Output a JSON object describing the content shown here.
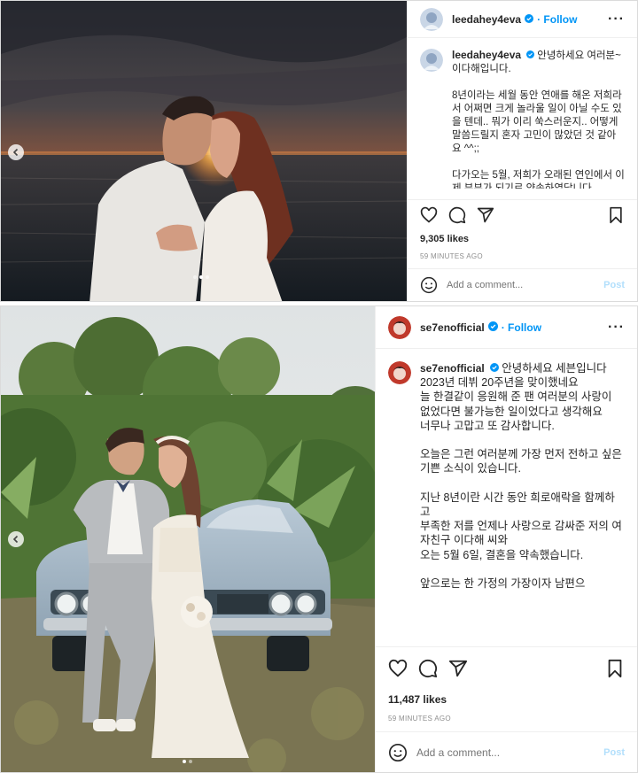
{
  "posts": [
    {
      "username": "leedahey4eva",
      "follow_label": "Follow",
      "more_label": "···",
      "caption": "안녕하세요 여러분~\n이다해입니다.\n\n8년이라는 세월 동안 연애를 해온 저희라서 어쩌면 크게 놀라울 일이 아닐 수도 있을 텐데.. 뭐가 이리 쑥스러운지.. 어떻게 말씀드릴지 혼자 고민이 많았던 것 같아요 ^^;;\n\n다가오는 5월, 저희가 오래된 연인에서 이제 부부가 되기로 약속하였답니다",
      "likes": "9,305 likes",
      "time": "59 MINUTES AGO",
      "comment_placeholder": "Add a comment...",
      "post_label": "Post"
    },
    {
      "username": "se7enofficial",
      "follow_label": "Follow",
      "more_label": "···",
      "caption": "안녕하세요 세븐입니다\n2023년 데뷔 20주년을 맞이했네요\n늘 한결같이 응원해 준 팬 여러분의 사랑이\n없었다면 불가능한 일이었다고 생각해요\n너무나 고맙고 또 감사합니다.\n\n오늘은 그런 여러분께 가장 먼저 전하고 싶은\n기쁜 소식이 있습니다.\n\n지난 8년이란 시간 동안 희로애락을 함께하고\n부족한 저를 언제나 사랑으로 감싸준 저의 여자친구 이다해 씨와\n오는 5월 6일, 결혼을 약속했습니다.\n\n앞으로는 한 가정의 가장이자 남편으",
      "likes": "11,487 likes",
      "time": "59 MINUTES AGO",
      "comment_placeholder": "Add a comment...",
      "post_label": "Post"
    }
  ],
  "icons": {
    "like": "heart-icon",
    "comment": "comment-icon",
    "share": "share-icon",
    "save": "bookmark-icon",
    "emoji": "emoji-icon",
    "verified": "verified-badge-icon",
    "prev": "chevron-left-icon"
  },
  "colors": {
    "link_blue": "#0095f6",
    "post_disabled": "#b2dffc",
    "muted": "#8e8e8e",
    "text": "#262626"
  },
  "carousel": {
    "post1_slides": 3,
    "post1_current": 2,
    "post2_slides": 2,
    "post2_current": 1
  }
}
